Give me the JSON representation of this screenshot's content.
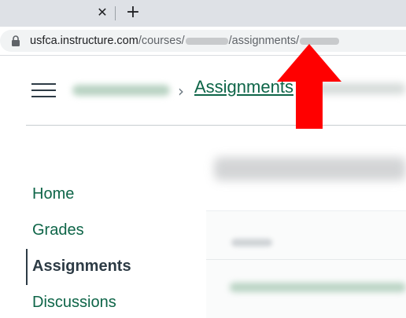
{
  "browser": {
    "tab_close_glyph": "✕",
    "new_tab_glyph": "+",
    "url": {
      "host": "usfca.instructure.com",
      "seg_courses": "/courses/",
      "seg_assignments": "/assignments/"
    }
  },
  "header": {
    "breadcrumb_separator": "›",
    "breadcrumb_current": "Assignments"
  },
  "sidebar": {
    "items": [
      {
        "label": "Home",
        "active": false
      },
      {
        "label": "Grades",
        "active": false
      },
      {
        "label": "Assignments",
        "active": true
      },
      {
        "label": "Discussions",
        "active": false
      }
    ]
  },
  "colors": {
    "link": "#0e6548",
    "text_dark": "#2d3b45",
    "arrow": "#ff0000"
  }
}
